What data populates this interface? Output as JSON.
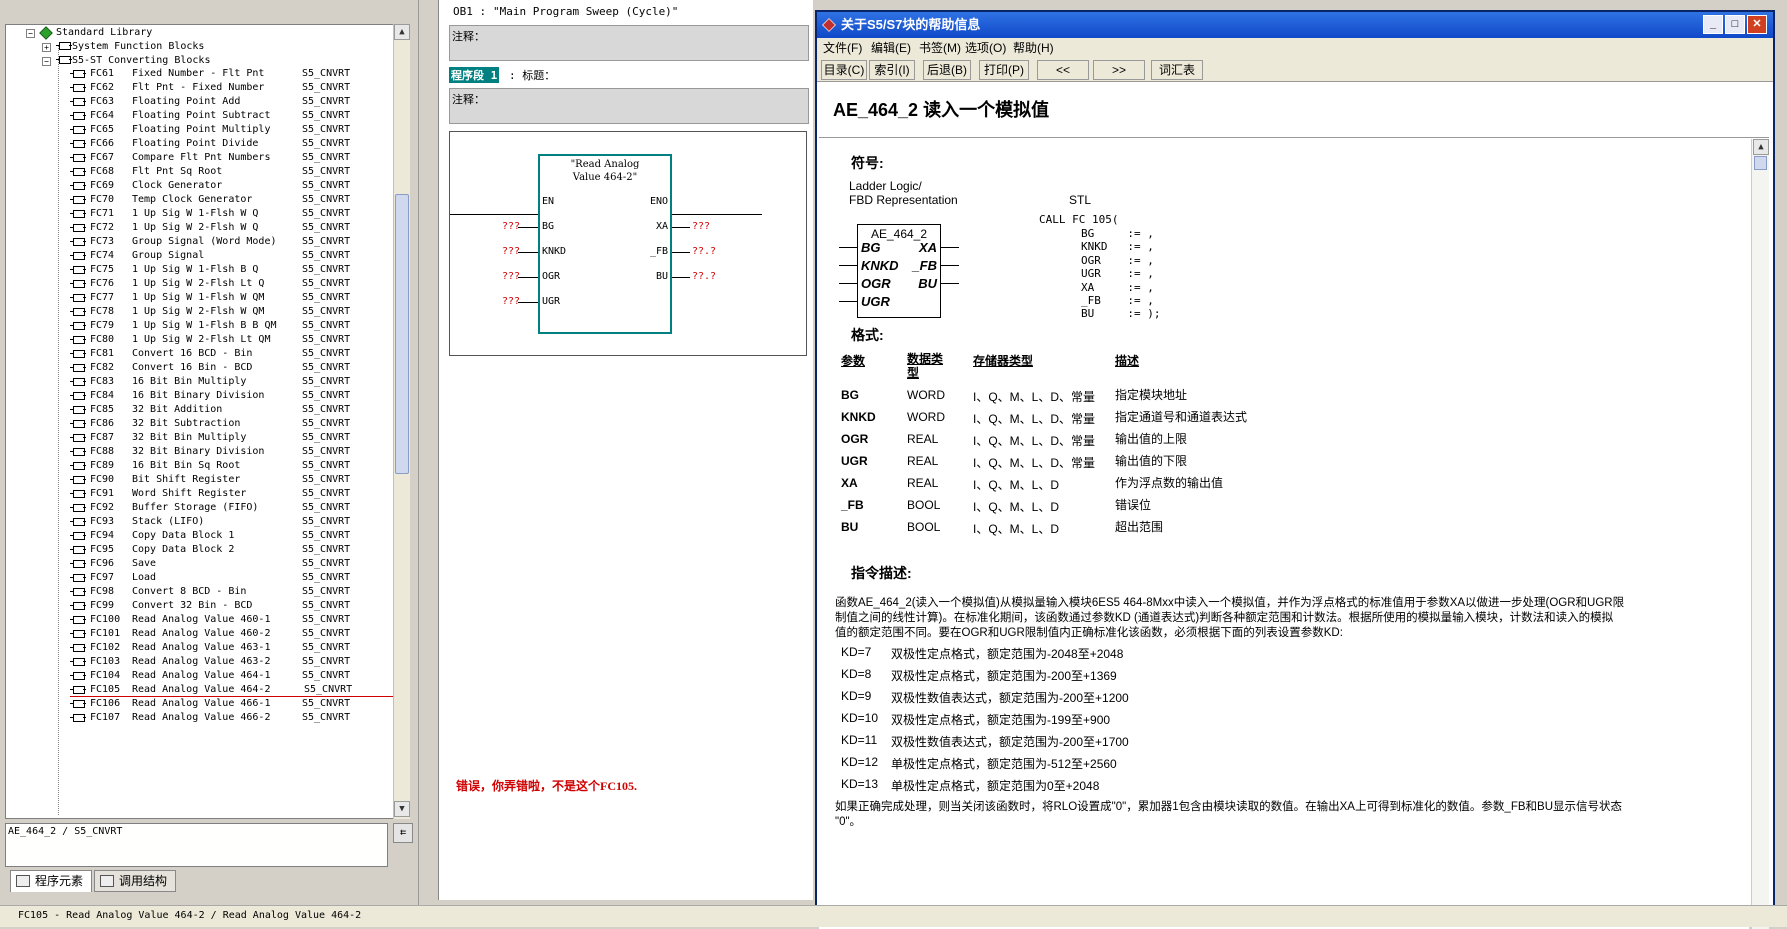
{
  "tree": {
    "root_label": "Standard Library",
    "sfb_label": "System Function Blocks",
    "s5_label": "S5-ST Converting Blocks",
    "items": [
      {
        "id": "FC61",
        "name": "Fixed Number - Flt Pnt",
        "fam": "S5_CNVRT"
      },
      {
        "id": "FC62",
        "name": "Flt Pnt - Fixed Number",
        "fam": "S5_CNVRT"
      },
      {
        "id": "FC63",
        "name": "Floating Point Add",
        "fam": "S5_CNVRT"
      },
      {
        "id": "FC64",
        "name": "Floating Point Subtract",
        "fam": "S5_CNVRT"
      },
      {
        "id": "FC65",
        "name": "Floating Point Multiply",
        "fam": "S5_CNVRT"
      },
      {
        "id": "FC66",
        "name": "Floating Point Divide",
        "fam": "S5_CNVRT"
      },
      {
        "id": "FC67",
        "name": "Compare Flt Pnt Numbers",
        "fam": "S5_CNVRT"
      },
      {
        "id": "FC68",
        "name": "Flt Pnt Sq Root",
        "fam": "S5_CNVRT"
      },
      {
        "id": "FC69",
        "name": "Clock Generator",
        "fam": "S5_CNVRT"
      },
      {
        "id": "FC70",
        "name": "Temp Clock Generator",
        "fam": "S5_CNVRT"
      },
      {
        "id": "FC71",
        "name": "1 Up Sig W 1-Flsh W Q",
        "fam": "S5_CNVRT"
      },
      {
        "id": "FC72",
        "name": "1 Up Sig W 2-Flsh W Q",
        "fam": "S5_CNVRT"
      },
      {
        "id": "FC73",
        "name": "Group Signal (Word Mode)",
        "fam": "S5_CNVRT"
      },
      {
        "id": "FC74",
        "name": "Group Signal",
        "fam": "S5_CNVRT"
      },
      {
        "id": "FC75",
        "name": "1 Up Sig W 1-Flsh B Q",
        "fam": "S5_CNVRT"
      },
      {
        "id": "FC76",
        "name": "1 Up Sig W 2-Flsh Lt Q",
        "fam": "S5_CNVRT"
      },
      {
        "id": "FC77",
        "name": "1 Up Sig W 1-Flsh W QM",
        "fam": "S5_CNVRT"
      },
      {
        "id": "FC78",
        "name": "1 Up Sig W 2-Flsh W QM",
        "fam": "S5_CNVRT"
      },
      {
        "id": "FC79",
        "name": "1 Up Sig W 1-Flsh B B QM",
        "fam": "S5_CNVRT"
      },
      {
        "id": "FC80",
        "name": "1 Up Sig W 2-Flsh Lt QM",
        "fam": "S5_CNVRT"
      },
      {
        "id": "FC81",
        "name": "Convert 16 BCD - Bin",
        "fam": "S5_CNVRT"
      },
      {
        "id": "FC82",
        "name": "Convert 16 Bin - BCD",
        "fam": "S5_CNVRT"
      },
      {
        "id": "FC83",
        "name": "16 Bit Bin Multiply",
        "fam": "S5_CNVRT"
      },
      {
        "id": "FC84",
        "name": "16 Bit Binary Division",
        "fam": "S5_CNVRT"
      },
      {
        "id": "FC85",
        "name": "32 Bit Addition",
        "fam": "S5_CNVRT"
      },
      {
        "id": "FC86",
        "name": "32 Bit Subtraction",
        "fam": "S5_CNVRT"
      },
      {
        "id": "FC87",
        "name": "32 Bit Bin Multiply",
        "fam": "S5_CNVRT"
      },
      {
        "id": "FC88",
        "name": "32 Bit Binary Division",
        "fam": "S5_CNVRT"
      },
      {
        "id": "FC89",
        "name": "16 Bit Bin Sq Root",
        "fam": "S5_CNVRT"
      },
      {
        "id": "FC90",
        "name": "Bit Shift Register",
        "fam": "S5_CNVRT"
      },
      {
        "id": "FC91",
        "name": "Word Shift Register",
        "fam": "S5_CNVRT"
      },
      {
        "id": "FC92",
        "name": "Buffer Storage (FIFO)",
        "fam": "S5_CNVRT"
      },
      {
        "id": "FC93",
        "name": "Stack (LIFO)",
        "fam": "S5_CNVRT"
      },
      {
        "id": "FC94",
        "name": "Copy Data Block 1",
        "fam": "S5_CNVRT"
      },
      {
        "id": "FC95",
        "name": "Copy Data Block 2",
        "fam": "S5_CNVRT"
      },
      {
        "id": "FC96",
        "name": "Save",
        "fam": "S5_CNVRT"
      },
      {
        "id": "FC97",
        "name": "Load",
        "fam": "S5_CNVRT"
      },
      {
        "id": "FC98",
        "name": "Convert 8 BCD - Bin",
        "fam": "S5_CNVRT"
      },
      {
        "id": "FC99",
        "name": "Convert 32 Bin - BCD",
        "fam": "S5_CNVRT"
      },
      {
        "id": "FC100",
        "name": "Read Analog Value 460-1",
        "fam": "S5_CNVRT"
      },
      {
        "id": "FC101",
        "name": "Read Analog Value 460-2",
        "fam": "S5_CNVRT"
      },
      {
        "id": "FC102",
        "name": "Read Analog Value 463-1",
        "fam": "S5_CNVRT"
      },
      {
        "id": "FC103",
        "name": "Read Analog Value 463-2",
        "fam": "S5_CNVRT"
      },
      {
        "id": "FC104",
        "name": "Read Analog Value 464-1",
        "fam": "S5_CNVRT"
      },
      {
        "id": "FC105",
        "name": "Read Analog Value 464-2",
        "fam": "S5_CNVRT"
      },
      {
        "id": "FC106",
        "name": "Read Analog Value 466-1",
        "fam": "S5_CNVRT"
      },
      {
        "id": "FC107",
        "name": "Read Analog Value 466-2",
        "fam": "S5_CNVRT"
      }
    ]
  },
  "left_path": "AE_464_2 / S5_CNVRT",
  "left_path_btn": "⇇",
  "tabs": {
    "elements": "程序元素",
    "call": "调用结构"
  },
  "statusbar": "FC105 - Read Analog Value 464-2 / Read Analog Value 464-2",
  "editor": {
    "ob_label": "OB1 :",
    "ob_title": "\"Main Program Sweep (Cycle)\"",
    "comment1": "注释：",
    "network_label": "程序段 1",
    "network_title": ": 标题：",
    "comment2": "注释：",
    "block_title": "\"Read Analog Value 464-2\"",
    "pins_in": [
      "EN",
      "BG",
      "KNKD",
      "OGR",
      "UGR"
    ],
    "pins_out": [
      "ENO",
      "XA",
      "_FB",
      "BU"
    ],
    "in_vals": [
      "???",
      "???",
      "???",
      "???"
    ],
    "out_vals": [
      "???",
      "??.?",
      "??.?"
    ],
    "annotation": "错误，你弄错啦，不是这个FC105."
  },
  "help": {
    "title": "关于S5/S7块的帮助信息",
    "menus": [
      "文件(F)",
      "编辑(E)",
      "书签(M)",
      "选项(O)",
      "帮助(H)"
    ],
    "toolbar": [
      "目录(C)",
      "索引(I)",
      "后退(B)",
      "打印(P)",
      "<<",
      ">>",
      "词汇表(G)"
    ],
    "heading": "AE_464_2  读入一个模拟值",
    "symbol_heading": "符号:",
    "ladder_label": "Ladder Logic/",
    "fbd_label": "FBD Representation",
    "stl_label": "STL",
    "sym_name": "AE_464_2",
    "sym_in": [
      "BG",
      "KNKD",
      "OGR",
      "UGR"
    ],
    "sym_out": [
      "XA",
      "_FB",
      "BU"
    ],
    "stl_call": "CALL FC 105(",
    "stl_lines": [
      "BG     := ,",
      "KNKD   := ,",
      "OGR    := ,",
      "UGR    := ,",
      "XA     := ,",
      "_FB    := ,",
      "BU     := );"
    ],
    "format_heading": "格式:",
    "col_headers": [
      "参数",
      "数据类型",
      "存储器类型",
      "描述"
    ],
    "params": [
      {
        "p": "BG",
        "t": "WORD",
        "m": "I、Q、M、L、D、常量",
        "d": "指定模块地址"
      },
      {
        "p": "KNKD",
        "t": "WORD",
        "m": "I、Q、M、L、D、常量",
        "d": "指定通道号和通道表达式"
      },
      {
        "p": "OGR",
        "t": "REAL",
        "m": "I、Q、M、L、D、常量",
        "d": "输出值的上限"
      },
      {
        "p": "UGR",
        "t": "REAL",
        "m": "I、Q、M、L、D、常量",
        "d": "输出值的下限"
      },
      {
        "p": "XA",
        "t": "REAL",
        "m": "I、Q、M、L、D",
        "d": "作为浮点数的输出值"
      },
      {
        "p": "_FB",
        "t": "BOOL",
        "m": "I、Q、M、L、D",
        "d": "错误位"
      },
      {
        "p": "BU",
        "t": "BOOL",
        "m": "I、Q、M、L、D",
        "d": "超出范围"
      }
    ],
    "desc_heading": "指令描述:",
    "desc_lines": [
      "函数AE_464_2(读入一个模拟值)从模拟量输入模块6ES5 464-8Mxx中读入一个模拟值，并作为浮点格式的标准值用于参数XA以做进一步处理(OGR和UGR限",
      "制值之间的线性计算)。在标准化期间，该函数通过参数KD (通道表达式)判断各种额定范围和计数法。根据所使用的模拟量输入模块，计数法和读入的模拟",
      "值的额定范围不同。要在OGR和UGR限制值内正确标准化该函数，必须根据下面的列表设置参数KD:"
    ],
    "kd": [
      {
        "k": "KD=7",
        "v": "双极性定点格式，额定范围为-2048至+2048"
      },
      {
        "k": "KD=8",
        "v": "双极性定点格式，额定范围为-200至+1369"
      },
      {
        "k": "KD=9",
        "v": "双极性数值表达式，额定范围为-200至+1200"
      },
      {
        "k": "KD=10",
        "v": "双极性定点格式，额定范围为-199至+900"
      },
      {
        "k": "KD=11",
        "v": "双极性数值表达式，额定范围为-200至+1700"
      },
      {
        "k": "KD=12",
        "v": "单极性定点格式，额定范围为-512至+2560"
      },
      {
        "k": "KD=13",
        "v": "单极性定点格式，额定范围为0至+2048"
      }
    ],
    "tail_lines": [
      "如果正确完成处理，则当关闭该函数时，将RLO设置成\"0\"，累加器1包含由模块读取的数值。在输出XA上可得到标准化的数值。参数_FB和BU显示信号状态",
      "\"0\"。"
    ]
  }
}
